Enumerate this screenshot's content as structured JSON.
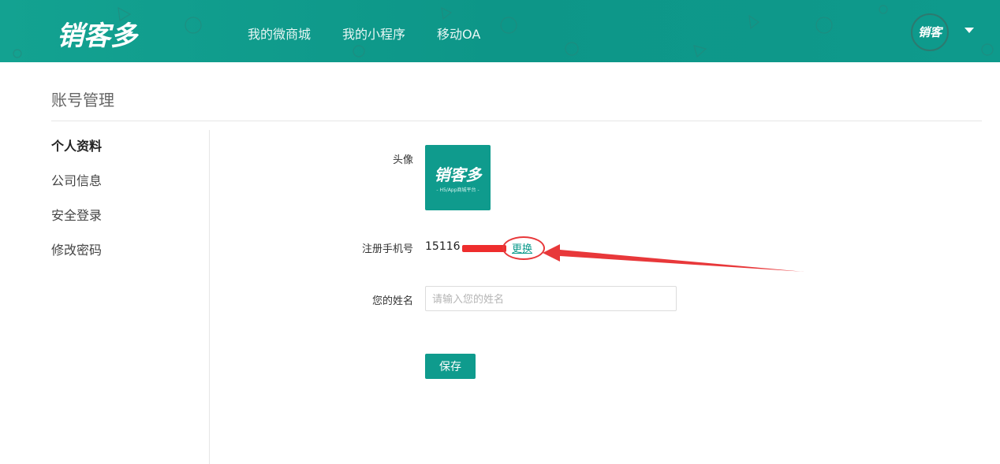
{
  "header": {
    "logo": "销客多",
    "nav": [
      "我的微商城",
      "我的小程序",
      "移动OA"
    ],
    "avatar_text": "销客多"
  },
  "page": {
    "title": "账号管理"
  },
  "sidebar": {
    "items": [
      {
        "label": "个人资料",
        "active": true
      },
      {
        "label": "公司信息",
        "active": false
      },
      {
        "label": "安全登录",
        "active": false
      },
      {
        "label": "修改密码",
        "active": false
      }
    ]
  },
  "form": {
    "avatar_label": "头像",
    "avatar_logo": "销客多",
    "avatar_sub": "- H5/App商城平台 -",
    "phone_label": "注册手机号",
    "phone_value": "15116",
    "change_link": "更换",
    "name_label": "您的姓名",
    "name_placeholder": "请输入您的姓名",
    "save_label": "保存"
  },
  "colors": {
    "brand": "#0f9b8d",
    "annotation": "#e8383a"
  }
}
